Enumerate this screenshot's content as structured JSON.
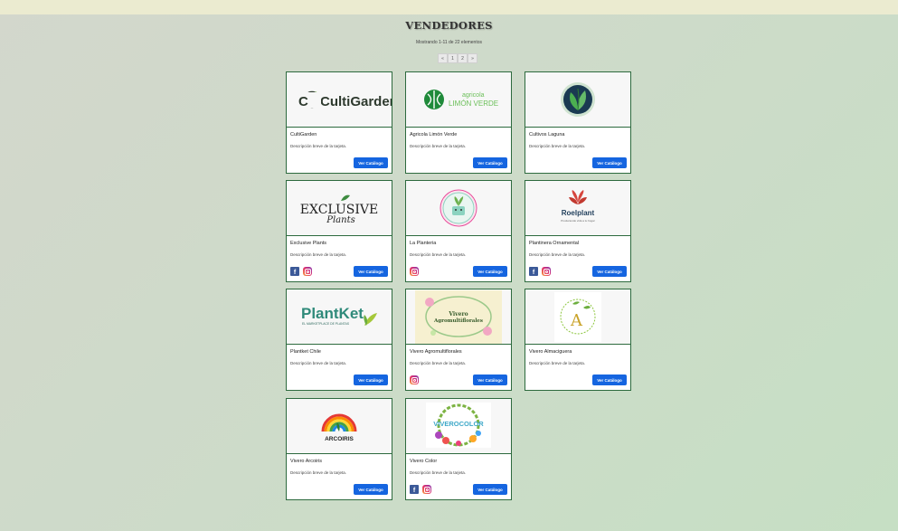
{
  "page": {
    "title": "VENDEDORES",
    "showing": "Mostrando 1-11 de 22 elementos",
    "pager": [
      "«",
      "1",
      "2",
      "»"
    ]
  },
  "vendors": [
    {
      "name": "CultiGarden",
      "description": "Descripción breve de la tarjeta.",
      "button": "Ver Catálogo",
      "logo_text": "CultiGarden",
      "facebook": false,
      "instagram": false
    },
    {
      "name": "Agricola Limón Verde",
      "description": "Descripción breve de la tarjeta.",
      "button": "Ver Catálogo",
      "logo_text_top": "agricola",
      "logo_text": "LIMÓN VERDE",
      "facebook": false,
      "instagram": false
    },
    {
      "name": "Cultivos Laguna",
      "description": "Descripción breve de la tarjeta.",
      "button": "Ver Catálogo",
      "facebook": false,
      "instagram": false
    },
    {
      "name": "Exclusive Plants",
      "description": "Descripción breve de la tarjeta.",
      "button": "Ver Catálogo",
      "logo_text": "EXCLUSIVE",
      "logo_text_sub": "Plants",
      "facebook": true,
      "instagram": true
    },
    {
      "name": "La Planteria",
      "description": "Descripción breve de la tarjeta.",
      "button": "Ver Catálogo",
      "facebook": false,
      "instagram": true
    },
    {
      "name": "Plantinera Ornamental",
      "description": "Descripción breve de la tarjeta.",
      "button": "Ver Catálogo",
      "logo_text": "Roelplant",
      "logo_text_sub": "Produciendo vida a tu hogar",
      "facebook": true,
      "instagram": true
    },
    {
      "name": "Plantket Chile",
      "description": "Descripción breve de la tarjeta.",
      "button": "Ver Catálogo",
      "logo_text": "PlantKet",
      "logo_text_sub": "EL MARKETPLACE DE PLANTAS",
      "facebook": false,
      "instagram": false
    },
    {
      "name": "Vivero Agromultiflorales",
      "description": "Descripción breve de la tarjeta.",
      "button": "Ver Catálogo",
      "logo_text": "Vivero",
      "logo_text_sub": "Agromultiflorales",
      "facebook": false,
      "instagram": true
    },
    {
      "name": "Vivero Almaciguera",
      "description": "Descripción breve de la tarjeta.",
      "button": "Ver Catálogo",
      "facebook": false,
      "instagram": false
    },
    {
      "name": "Vivero Arcoiris",
      "description": "Descripción breve de la tarjeta.",
      "button": "Ver Catálogo",
      "logo_text": "ARCOIRIS",
      "facebook": false,
      "instagram": false
    },
    {
      "name": "Vivero Color",
      "description": "Descripción breve de la tarjeta.",
      "button": "Ver Catálogo",
      "logo_text": "VIVEROCOLOR",
      "facebook": true,
      "instagram": true
    }
  ],
  "colors": {
    "button": "#1565e0",
    "card_border": "#2d6a3e",
    "topbar": "#ebebd0"
  }
}
